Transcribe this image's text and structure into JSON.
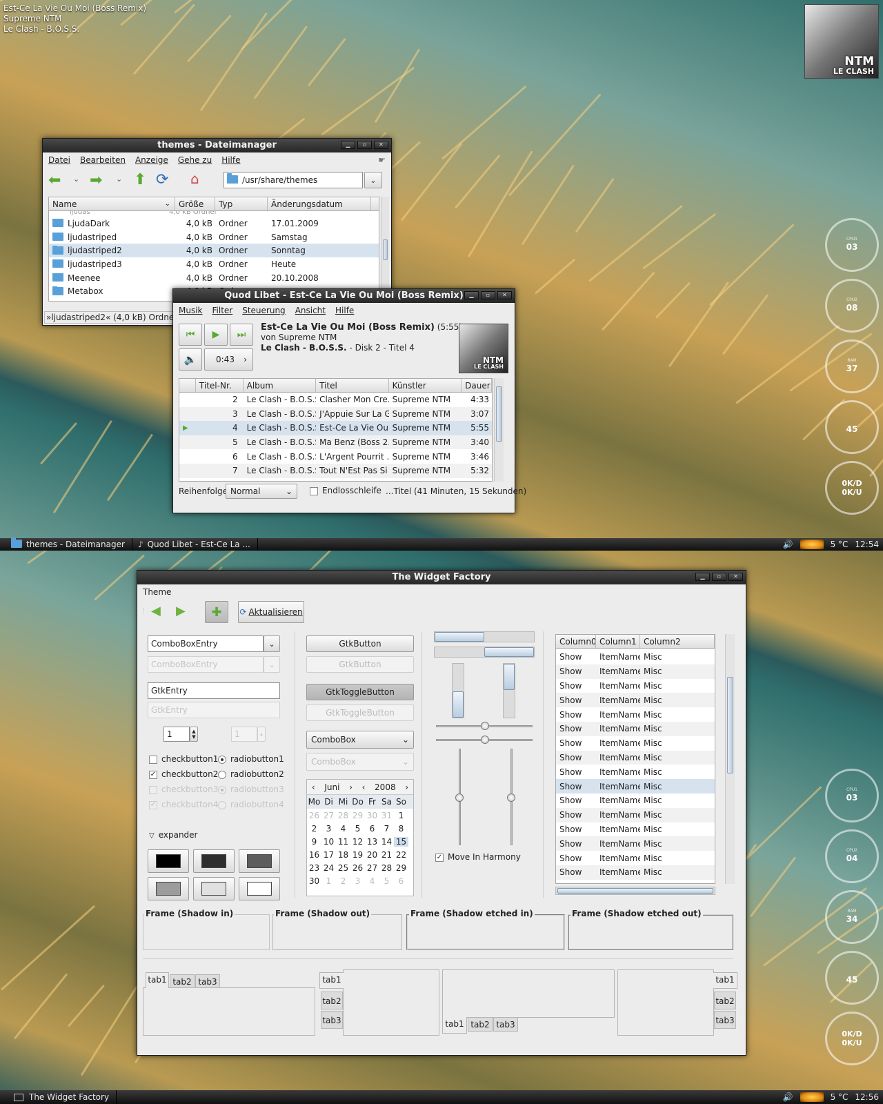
{
  "desktop": {
    "now_playing": [
      "Est-Ce La Vie Ou Moi (Boss Remix)",
      "Supreme NTM",
      "Le Clash - B.O.S.S."
    ],
    "cover_text": [
      "NTM",
      "LE CLASH"
    ],
    "conky_top": [
      {
        "label": "CPU1",
        "value": "03"
      },
      {
        "label": "CPU2",
        "value": "08"
      },
      {
        "label": "RAM",
        "value": "37"
      },
      {
        "label": "",
        "value": "45"
      },
      {
        "label": "",
        "value": "0K/D\n0K/U"
      }
    ],
    "conky_bottom": [
      {
        "label": "CPU1",
        "value": "03"
      },
      {
        "label": "CPU2",
        "value": "04"
      },
      {
        "label": "RAM",
        "value": "34"
      },
      {
        "label": "",
        "value": "45"
      },
      {
        "label": "",
        "value": "0K/D\n0K/U"
      }
    ]
  },
  "filemanager": {
    "title": "themes - Dateimanager",
    "menu": [
      "Datei",
      "Bearbeiten",
      "Anzeige",
      "Gehe zu",
      "Hilfe"
    ],
    "location": "/usr/share/themes",
    "columns": [
      "Name",
      "Größe",
      "Typ",
      "Änderungsdatum"
    ],
    "rows": [
      {
        "name": "LjudaDark",
        "size": "4,0 kB",
        "type": "Ordner",
        "date": "17.01.2009"
      },
      {
        "name": "ljudastriped",
        "size": "4,0 kB",
        "type": "Ordner",
        "date": "Samstag"
      },
      {
        "name": "ljudastriped2",
        "size": "4,0 kB",
        "type": "Ordner",
        "date": "Sonntag"
      },
      {
        "name": "ljudastriped3",
        "size": "4,0 kB",
        "type": "Ordner",
        "date": "Heute"
      },
      {
        "name": "Meenee",
        "size": "4,0 kB",
        "type": "Ordner",
        "date": "20.10.2008"
      },
      {
        "name": "Metabox",
        "size": "4,0 kB",
        "type": "Ordner",
        "date": ""
      }
    ],
    "status": "»ljudastriped2« (4,0 kB) Ordner"
  },
  "player": {
    "title": "Quod Libet - Est-Ce La Vie Ou Moi (Boss Remix)",
    "menu": [
      "Musik",
      "Filter",
      "Steuerung",
      "Ansicht",
      "Hilfe"
    ],
    "song": "Est-Ce La Vie Ou Moi (Boss Remix)",
    "duration": "(5:55)",
    "by": "von Supreme NTM",
    "album": "Le Clash - B.O.S.S.",
    "disc": " - Disk 2 - Titel 4",
    "position": "0:43",
    "columns": [
      "Titel-Nr.",
      "Album",
      "Titel",
      "Künstler",
      "Dauer"
    ],
    "rows": [
      {
        "nr": "2",
        "album": "Le Clash - B.O.S.S.",
        "title": "Clasher Mon Cre...",
        "artist": "Supreme NTM",
        "dur": "4:33"
      },
      {
        "nr": "3",
        "album": "Le Clash - B.O.S.S.",
        "title": "J'Appuie Sur La G...",
        "artist": "Supreme NTM",
        "dur": "3:07"
      },
      {
        "nr": "4",
        "album": "Le Clash - B.O.S.S.",
        "title": "Est-Ce La Vie Ou ...",
        "artist": "Supreme NTM",
        "dur": "5:55"
      },
      {
        "nr": "5",
        "album": "Le Clash - B.O.S.S.",
        "title": "Ma Benz (Boss 2...",
        "artist": "Supreme NTM",
        "dur": "3:40"
      },
      {
        "nr": "6",
        "album": "Le Clash - B.O.S.S.",
        "title": "L'Argent Pourrit ...",
        "artist": "Supreme NTM",
        "dur": "3:46"
      },
      {
        "nr": "7",
        "album": "Le Clash - B.O.S.S.",
        "title": "Tout N'Est Pas Si ...",
        "artist": "Supreme NTM",
        "dur": "5:32"
      }
    ],
    "order_label": "Reihenfolge:",
    "order_value": "Normal",
    "repeat_label": "Endlosschleife",
    "summary": "...Titel (41 Minuten, 15 Sekunden)"
  },
  "taskbar_top": {
    "tasks": [
      "themes - Dateimanager",
      "Quod Libet - Est-Ce La ..."
    ],
    "temp": "5 °C",
    "time": "12:54"
  },
  "taskbar_bottom": {
    "tasks": [
      "The Widget Factory"
    ],
    "temp": "5 °C",
    "time": "12:56"
  },
  "factory": {
    "title": "The Widget Factory",
    "menu": [
      "Theme"
    ],
    "refresh": "Aktualisieren",
    "combo_entry": "ComboBoxEntry",
    "gtk_entry": "GtkEntry",
    "spin": "1",
    "check1": "checkbutton1",
    "check2": "checkbutton2",
    "check3": "checkbutton3",
    "check4": "checkbutton4",
    "radio1": "radiobutton1",
    "radio2": "radiobutton2",
    "radio3": "radiobutton3",
    "radio4": "radiobutton4",
    "expander": "expander",
    "gtk_button": "GtkButton",
    "toggle_button": "GtkToggleButton",
    "combo": "ComboBox",
    "cal_month": "Juni",
    "cal_year": "2008",
    "cal_days": [
      "Mo",
      "Di",
      "Mi",
      "Do",
      "Fr",
      "Sa",
      "So"
    ],
    "cal_weeks": [
      [
        "26",
        "27",
        "28",
        "29",
        "30",
        "31",
        "1"
      ],
      [
        "2",
        "3",
        "4",
        "5",
        "6",
        "7",
        "8"
      ],
      [
        "9",
        "10",
        "11",
        "12",
        "13",
        "14",
        "15"
      ],
      [
        "16",
        "17",
        "18",
        "19",
        "20",
        "21",
        "22"
      ],
      [
        "23",
        "24",
        "25",
        "26",
        "27",
        "28",
        "29"
      ],
      [
        "30",
        "1",
        "2",
        "3",
        "4",
        "5",
        "6"
      ]
    ],
    "harmony": "Move In Harmony",
    "tree_columns": [
      "Column0",
      "Column1",
      "Column2"
    ],
    "tree_row": [
      "Show",
      "ItemName",
      "Misc"
    ],
    "frames": [
      "Frame (Shadow in)",
      "Frame (Shadow out)",
      "Frame (Shadow etched in)",
      "Frame (Shadow etched out)"
    ],
    "tabs": [
      "tab1",
      "tab2",
      "tab3"
    ],
    "swatches": [
      "#000000",
      "#2e2e2e",
      "#5c5c5c",
      "#9c9c9c",
      "#e0e0e0",
      "#ffffff"
    ]
  }
}
